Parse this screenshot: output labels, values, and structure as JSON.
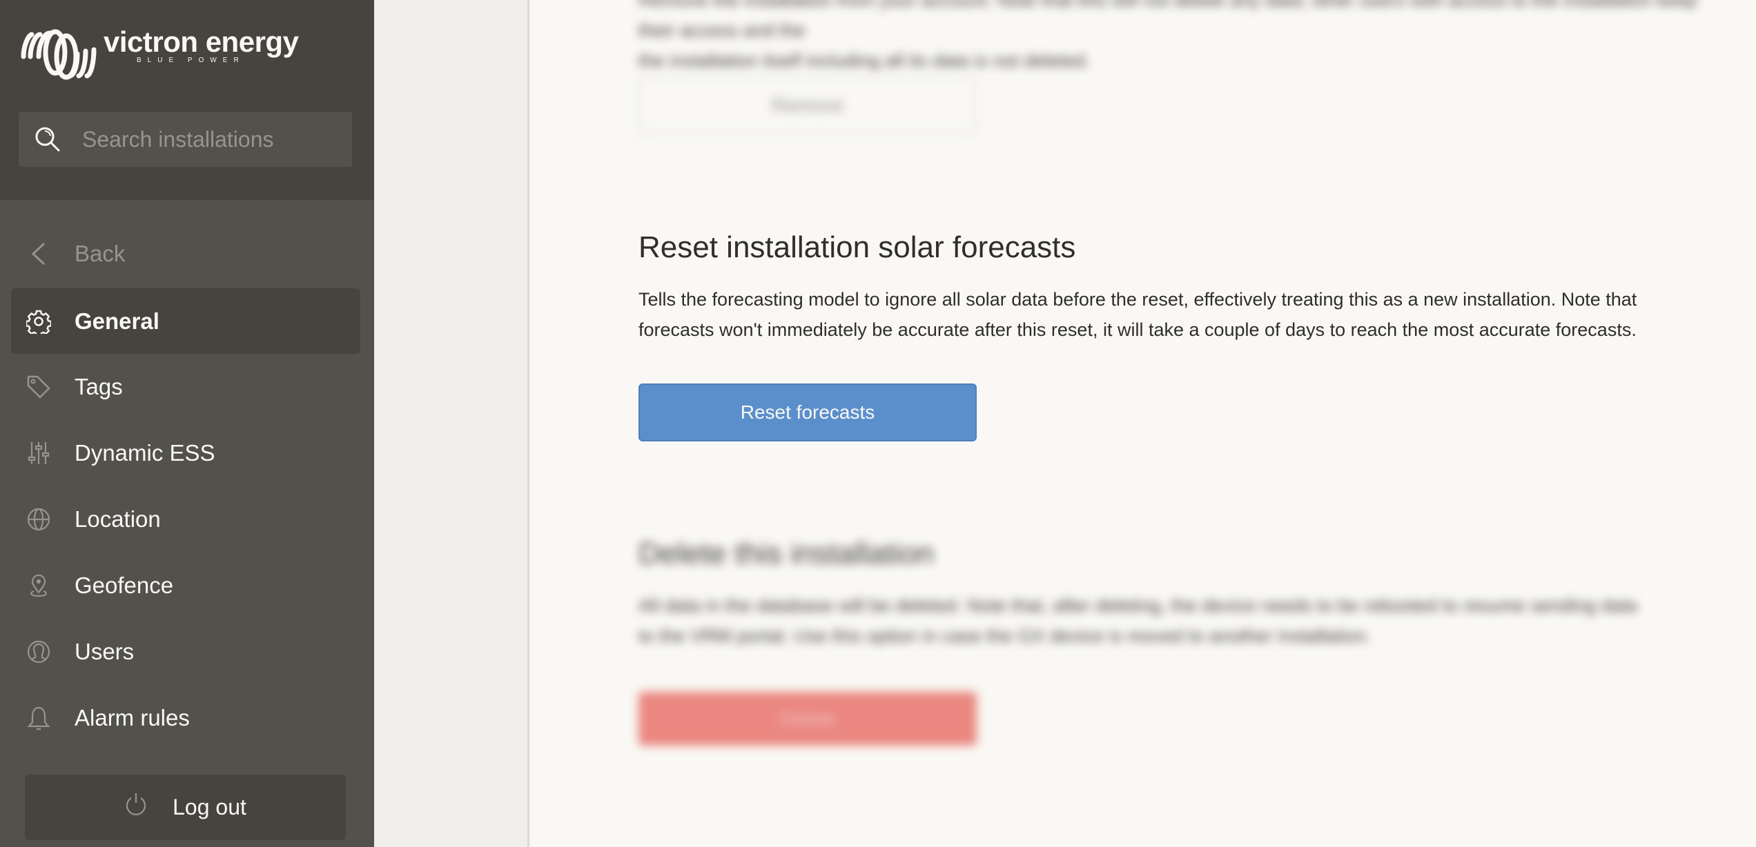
{
  "brand": {
    "name": "victron energy",
    "tagline": "BLUE POWER"
  },
  "search": {
    "placeholder": "Search installations",
    "value": ""
  },
  "sidebar": {
    "back_label": "Back",
    "items": [
      {
        "label": "General",
        "icon": "gear-icon",
        "active": true
      },
      {
        "label": "Tags",
        "icon": "tag-icon",
        "active": false
      },
      {
        "label": "Dynamic ESS",
        "icon": "sliders-icon",
        "active": false
      },
      {
        "label": "Location",
        "icon": "globe-icon",
        "active": false
      },
      {
        "label": "Geofence",
        "icon": "map-pin-icon",
        "active": false
      },
      {
        "label": "Users",
        "icon": "user-icon",
        "active": false
      },
      {
        "label": "Alarm rules",
        "icon": "bell-icon",
        "active": false
      }
    ],
    "logout_label": "Log out"
  },
  "content": {
    "top_section": {
      "text_line1": "Remove the installation from your account. Note that this will not delete any data; other users with access to the installation keep their access and the",
      "text_line2": "the installation itself including all its data is not deleted.",
      "button_label": "Remove"
    },
    "reset_section": {
      "title": "Reset installation solar forecasts",
      "description_line1": "Tells the forecasting model to ignore all solar data before the reset, effectively treating this as a new installation. Note that",
      "description_line2": "forecasts won't immediately be accurate after this reset, it will take a couple of days to reach the most accurate forecasts.",
      "button_label": "Reset forecasts"
    },
    "delete_section": {
      "title": "Delete this installation",
      "description_line1": "All data in the database will be deleted. Note that, after deleting, the device needs to be rebooted to resume sending data",
      "description_line2": "to the VRM portal. Use this option in case the GX device is moved to another installation.",
      "button_label": "Delete"
    }
  },
  "colors": {
    "sidebar_dark": "#46443f",
    "sidebar": "#53514c",
    "content_bg": "#f9f8f4",
    "primary_button": "#5b8fcc",
    "danger_button": "#e97b74"
  }
}
